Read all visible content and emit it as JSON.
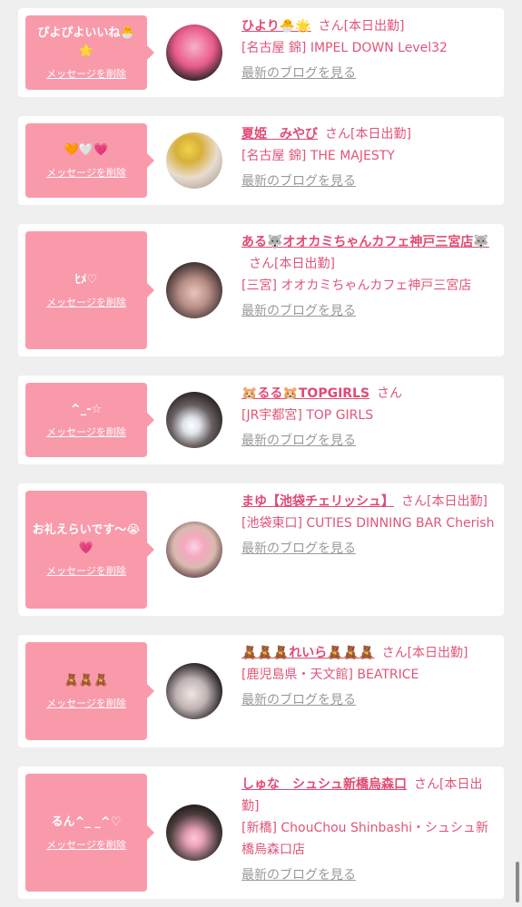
{
  "delete_label": "メッセージを削除",
  "blog_label": "最新のブログを見る",
  "san_label": "さん",
  "cards": [
    {
      "message": "ぴよぴよいいね🐣🌟",
      "name": "ひより🐣🌟",
      "work": "[本日出勤]",
      "shop": "[名古屋 錦] IMPEL DOWN Level32"
    },
    {
      "message": "🧡🤍💗",
      "name": "夏姫　みやび",
      "work": "[本日出勤]",
      "shop": "[名古屋 錦] THE MAJESTY"
    },
    {
      "message": "ﾋﾒ♡",
      "name": "ある🐺オオカミちゃんカフェ神戸三宮店🐺",
      "work": "[本日出勤]",
      "shop": "[三宮] オオカミちゃんカフェ神戸三宮店"
    },
    {
      "message": "^_-☆",
      "name": "🐹るる🐹TOPGIRLS",
      "work": "",
      "shop": "[JR宇都宮] TOP GIRLS"
    },
    {
      "message": "お礼えらいです〜😭💗",
      "name": "まゆ【池袋チェリッシュ】",
      "work": "[本日出勤]",
      "shop": "[池袋東口] CUTIES DINNING BAR Cherish"
    },
    {
      "message": "🧸🧸🧸",
      "name": "🧸🧸🧸れいら🧸🧸🧸",
      "work": "[本日出勤]",
      "shop": "[鹿児島県・天文館] BEATRICE"
    },
    {
      "message": "るん^_ _^♡",
      "name": "しゅな　シュシュ新橋烏森口",
      "work": "[本日出勤]",
      "shop": "[新橋] ChouChou Shinbashi・シュシュ新橋烏森口店"
    }
  ],
  "colors": {
    "bubble": "#f99aab",
    "name": "#e14a73",
    "background": "#efefef"
  }
}
